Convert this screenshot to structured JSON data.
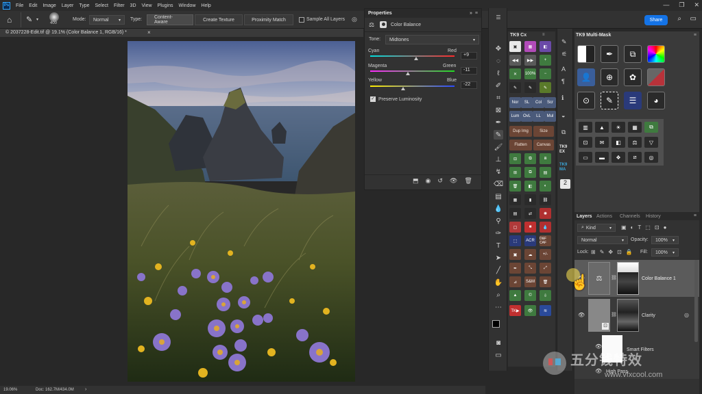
{
  "app": {
    "menu": [
      "File",
      "Edit",
      "Image",
      "Layer",
      "Type",
      "Select",
      "Filter",
      "3D",
      "View",
      "Plugins",
      "Window",
      "Help"
    ],
    "logo": "Ps"
  },
  "options_bar": {
    "brush_size": "400",
    "mode_label": "Mode:",
    "mode_value": "Normal",
    "type_label": "Type:",
    "type_buttons": [
      "Content-Aware",
      "Create Texture",
      "Proximity Match"
    ],
    "sample_all_layers": "Sample All Layers",
    "share": "Share"
  },
  "document": {
    "tab_title": "© 2037228-Edit.tif @ 19.1% (Color Balance 1, RGB/16) *",
    "close": "×",
    "zoom": "19.06%",
    "doc_info": "Doc: 162.7M/434.0M"
  },
  "properties": {
    "title": "Properties",
    "adjustment": "Color Balance",
    "tone_label": "Tone:",
    "tone_value": "Midtones",
    "sliders": [
      {
        "left": "Cyan",
        "right": "Red",
        "value": "+9",
        "pos": 0.545
      },
      {
        "left": "Magenta",
        "right": "Green",
        "value": "-11",
        "pos": 0.445
      },
      {
        "left": "Yellow",
        "right": "Blue",
        "value": "-22",
        "pos": 0.39
      }
    ],
    "preserve_luminosity": "Preserve Luminosity"
  },
  "tk9cx": {
    "title": "TK9 Cx",
    "labels": [
      "100%",
      "Nor",
      "SL",
      "Col",
      "Scr",
      "Lum",
      "OvL",
      "LL",
      "Mul",
      "Dup Img",
      "Size",
      "Flatten",
      "Canvas",
      "ACR",
      "D&F CAF",
      "+/-",
      "S&M",
      "©",
      "TK▶"
    ]
  },
  "tk9ma": {
    "tk_label": "TK9 EX",
    "ma_label": "TK9 MA"
  },
  "multimask": {
    "title": "TK9 Multi-Mask"
  },
  "layers_panel": {
    "tabs": [
      "Layers",
      "Actions",
      "Channels",
      "History"
    ],
    "kind": "Kind",
    "blend_mode": "Normal",
    "opacity_label": "Opacity:",
    "opacity_value": "100%",
    "lock_label": "Lock:",
    "fill_label": "Fill:",
    "fill_value": "100%",
    "layers": [
      {
        "name": "Color Balance 1"
      },
      {
        "name": "Clarity"
      },
      {
        "name": "Smart Filters"
      },
      {
        "name": "High Pass"
      }
    ]
  },
  "watermark": {
    "brand": "五分钱特效",
    "url": "www.vfxcool.com"
  }
}
